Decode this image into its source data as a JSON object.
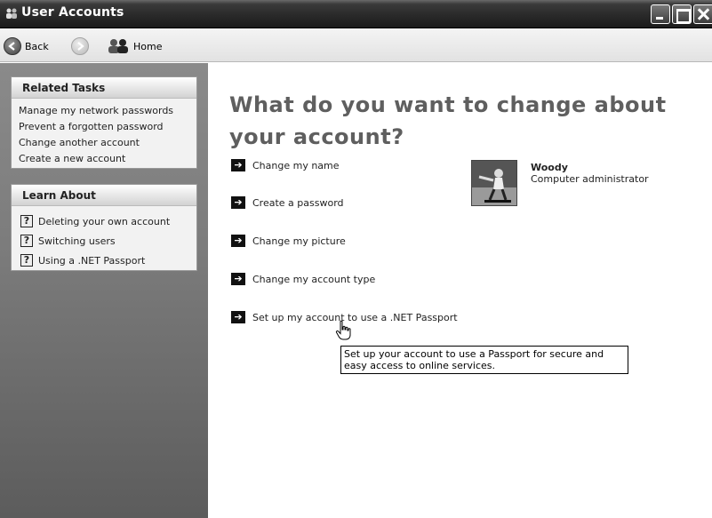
{
  "window": {
    "title": "User Accounts",
    "app_icon": "users-icon",
    "controls": [
      "minimize-icon",
      "maximize-icon",
      "close-icon"
    ]
  },
  "toolbar": {
    "back_label": "Back",
    "forward_icon": "forward-arrow-icon",
    "home_label": "Home"
  },
  "sidebar": {
    "related_tasks": {
      "title": "Related Tasks",
      "items": [
        "Manage my network passwords",
        "Prevent a forgotten password",
        "Change another account",
        "Create a new account"
      ]
    },
    "learn_about": {
      "title": "Learn About",
      "items": [
        "Deleting your own account",
        "Switching users",
        "Using a .NET Passport"
      ]
    }
  },
  "main": {
    "heading": "What do you want to change about your account?",
    "actions": [
      "Change my name",
      "Create a password",
      "Change my picture",
      "Change my account type",
      "Set up my account to use a .NET Passport"
    ]
  },
  "user": {
    "name": "Woody",
    "role": "Computer administrator"
  },
  "tooltip": {
    "text": "Set up your account to use a Passport for secure and easy access to online services."
  }
}
